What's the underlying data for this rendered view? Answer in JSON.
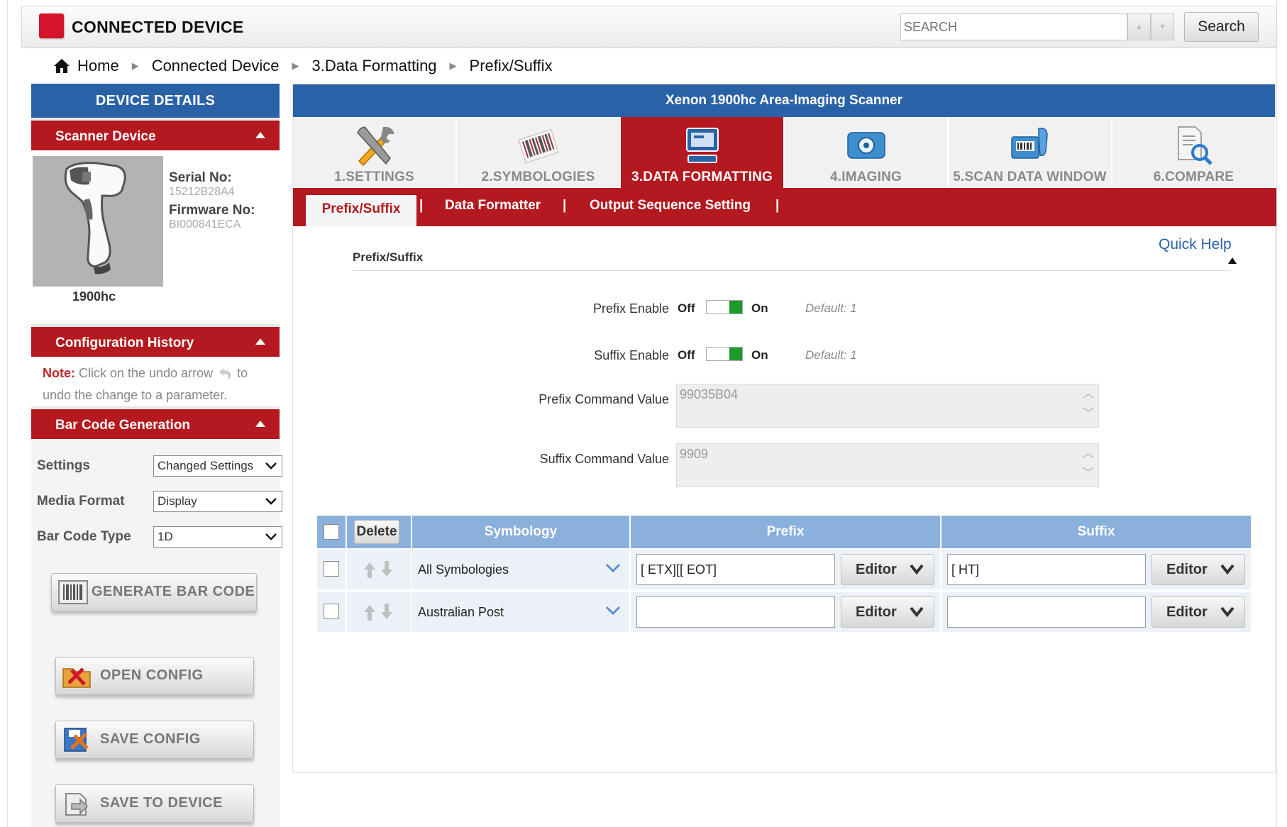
{
  "header": {
    "brand": "CONNECTED DEVICE",
    "search_placeholder": "SEARCH",
    "search_button": "Search"
  },
  "breadcrumb": [
    "Home",
    "Connected Device",
    "3.Data Formatting",
    "Prefix/Suffix"
  ],
  "sidebar": {
    "device_details": "DEVICE DETAILS",
    "scanner_section": "Scanner Device",
    "serial_label": "Serial No:",
    "serial_value": "15212B28A4",
    "firmware_label": "Firmware No:",
    "firmware_value": "BI000841ECA",
    "model": "1900hc",
    "config_history": "Configuration History",
    "note_label": "Note:",
    "note_text_1": " Click on the undo arrow ",
    "note_text_2": " to",
    "note_text_3": "undo the change to a parameter.",
    "barcode_section": "Bar Code Generation",
    "settings_label": "Settings",
    "settings_value": "Changed Settings",
    "media_label": "Media Format",
    "media_value": "Display",
    "bartype_label": "Bar Code Type",
    "bartype_value": "1D",
    "generate_button": "GENERATE BAR CODE",
    "open_config": "OPEN CONFIG",
    "save_config": "SAVE CONFIG",
    "save_device": "SAVE TO DEVICE"
  },
  "main": {
    "title": "Xenon 1900hc Area-Imaging Scanner",
    "tabs": [
      "1.SETTINGS",
      "2.SYMBOLOGIES",
      "3.DATA FORMATTING",
      "4.IMAGING",
      "5.SCAN DATA WINDOW",
      "6.COMPARE"
    ],
    "active_tab": 2,
    "subtabs": [
      "Prefix/Suffix",
      "Data Formatter",
      "Output Sequence Setting"
    ],
    "section_title": "Prefix/Suffix",
    "quick_help": "Quick Help",
    "off": "Off",
    "on": "On",
    "prefix_enable_label": "Prefix Enable",
    "prefix_default": "Default: 1",
    "suffix_enable_label": "Suffix Enable",
    "suffix_default": "Default: 1",
    "prefix_cmd_label": "Prefix Command Value",
    "prefix_cmd_value": "99035B04",
    "suffix_cmd_label": "Suffix Command Value",
    "suffix_cmd_value": "9909"
  },
  "table": {
    "delete_button": "Delete",
    "col_symbology": "Symbology",
    "col_prefix": "Prefix",
    "col_suffix": "Suffix",
    "editor_label": "Editor",
    "rows": [
      {
        "symbology": "All Symbologies",
        "prefix": "[ ETX][[ EOT]",
        "suffix": "[ HT]"
      },
      {
        "symbology": "Australian Post",
        "prefix": "",
        "suffix": ""
      }
    ]
  }
}
